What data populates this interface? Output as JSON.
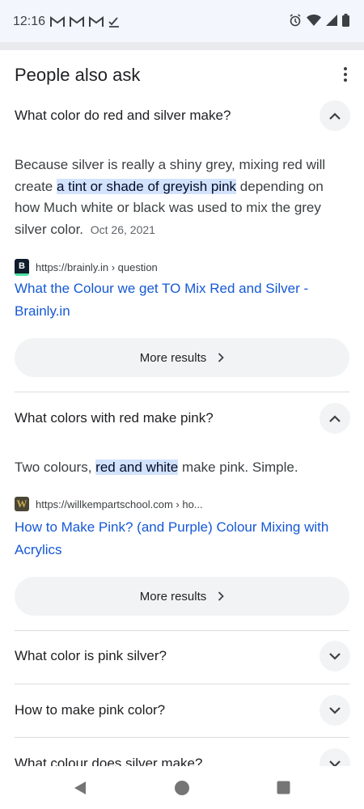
{
  "status_bar": {
    "time": "12:16",
    "left_icons": [
      "gmail-icon",
      "gmail-icon",
      "gmail-icon",
      "check-icon"
    ],
    "right_icons": [
      "alarm-icon",
      "wifi-icon",
      "signal-icon",
      "battery-icon"
    ]
  },
  "paa": {
    "title": "People also ask",
    "questions": [
      {
        "question": "What color do red and silver make?",
        "expanded": true,
        "answer_before": "Because silver is really a shiny grey, mixing red will create ",
        "answer_highlight": "a tint or shade of greyish pink",
        "answer_after": " depending on how Much white or black was used to mix the grey silver color.",
        "date": "Oct 26, 2021",
        "source_url": "https://brainly.in › question",
        "source_title": "What the Colour we get TO Mix Red and Silver - Brainly.in",
        "favicon_letter": "B",
        "more_label": "More results"
      },
      {
        "question": "What colors with red make pink?",
        "expanded": true,
        "answer_before": "Two colours, ",
        "answer_highlight": "red and white",
        "answer_after": " make pink. Simple.",
        "source_url": "https://willkempartschool.com › ho...",
        "source_title": "How to Make Pink? (and Purple) Colour Mixing with Acrylics",
        "favicon_letter": "W",
        "more_label": "More results"
      },
      {
        "question": "What color is pink silver?",
        "expanded": false
      },
      {
        "question": "How to make pink color?",
        "expanded": false
      },
      {
        "question": "What colour does silver make?",
        "expanded": false
      }
    ]
  },
  "colors": {
    "highlight": "#d3e3fd",
    "link": "#1558d6",
    "chip_bg": "#f1f3f4"
  }
}
